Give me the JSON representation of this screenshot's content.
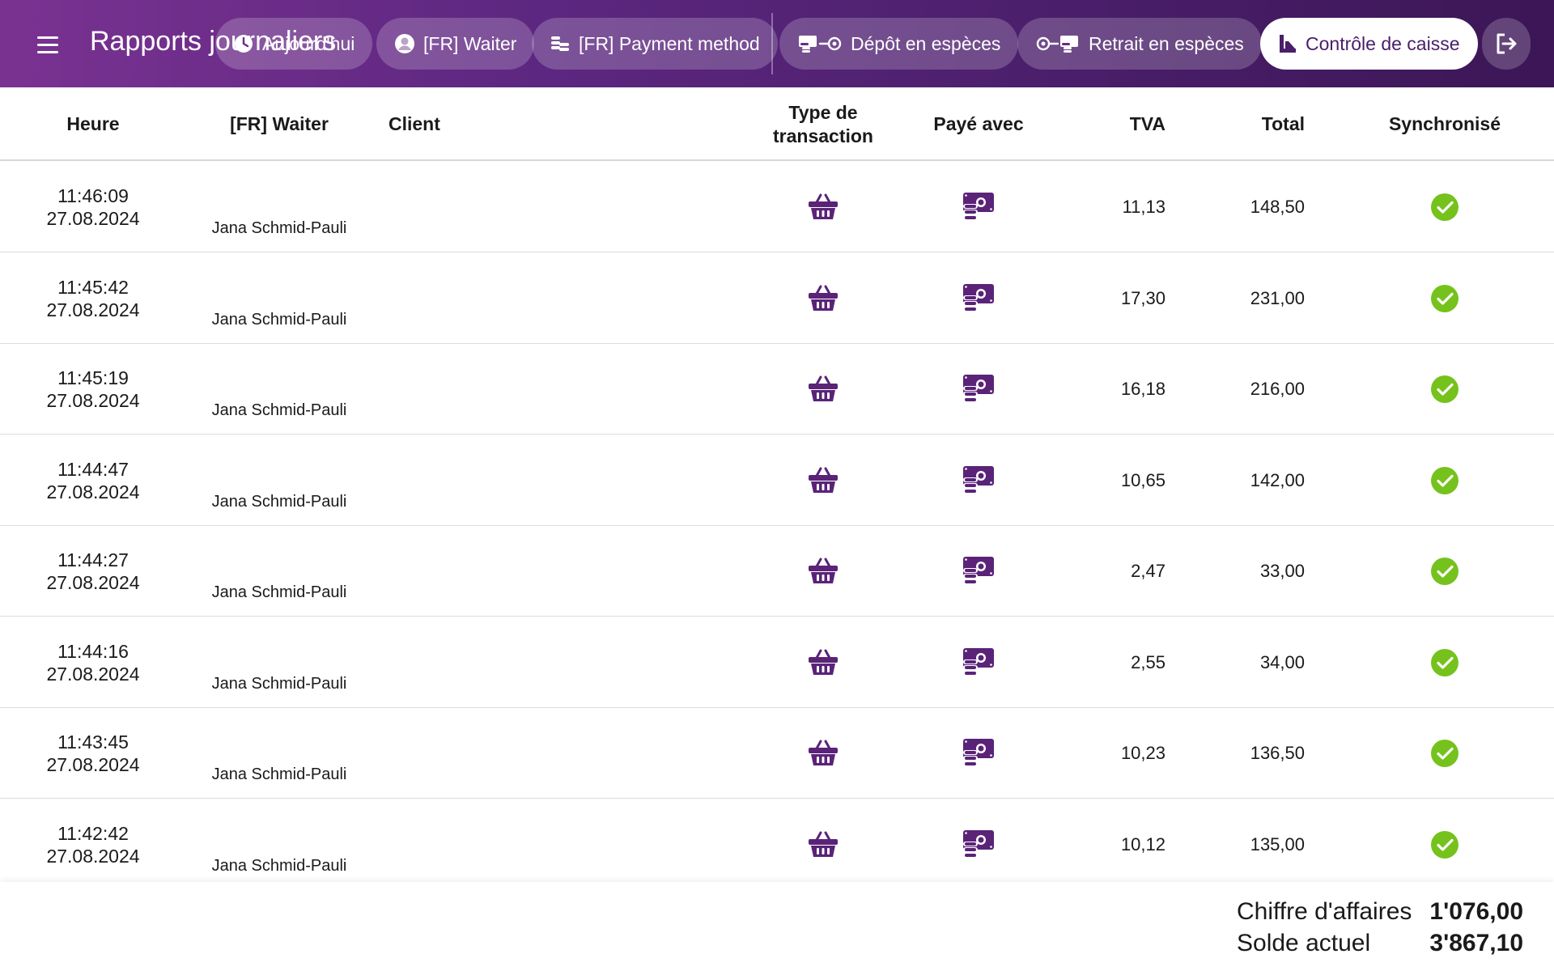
{
  "header": {
    "title": "Rapports journaliers",
    "buttons": {
      "today": "Aujourd'hui",
      "waiter": "[FR] Waiter",
      "payment_method": "[FR] Payment method",
      "cash_deposit": "Dépôt en espèces",
      "cash_withdrawal": "Retrait en espèces",
      "cash_control": "Contrôle de caisse"
    },
    "active_button": "cash_control"
  },
  "table": {
    "columns": {
      "time": "Heure",
      "waiter": "[FR] Waiter",
      "client": "Client",
      "transaction_type_line1": "Type de",
      "transaction_type_line2": "transaction",
      "paid_with": "Payé avec",
      "vat": "TVA",
      "total": "Total",
      "synced": "Synchronisé"
    },
    "rows": [
      {
        "time": "11:46:09",
        "date": "27.08.2024",
        "waiter": "Jana Schmid-Pauli",
        "client": "",
        "transaction_icon": "basket-icon",
        "payment_icon": "cash-icon",
        "vat": "11,13",
        "total": "148,50",
        "synced": true
      },
      {
        "time": "11:45:42",
        "date": "27.08.2024",
        "waiter": "Jana Schmid-Pauli",
        "client": "",
        "transaction_icon": "basket-icon",
        "payment_icon": "cash-icon",
        "vat": "17,30",
        "total": "231,00",
        "synced": true
      },
      {
        "time": "11:45:19",
        "date": "27.08.2024",
        "waiter": "Jana Schmid-Pauli",
        "client": "",
        "transaction_icon": "basket-icon",
        "payment_icon": "cash-icon",
        "vat": "16,18",
        "total": "216,00",
        "synced": true
      },
      {
        "time": "11:44:47",
        "date": "27.08.2024",
        "waiter": "Jana Schmid-Pauli",
        "client": "",
        "transaction_icon": "basket-icon",
        "payment_icon": "cash-icon",
        "vat": "10,65",
        "total": "142,00",
        "synced": true
      },
      {
        "time": "11:44:27",
        "date": "27.08.2024",
        "waiter": "Jana Schmid-Pauli",
        "client": "",
        "transaction_icon": "basket-icon",
        "payment_icon": "cash-icon",
        "vat": "2,47",
        "total": "33,00",
        "synced": true
      },
      {
        "time": "11:44:16",
        "date": "27.08.2024",
        "waiter": "Jana Schmid-Pauli",
        "client": "",
        "transaction_icon": "basket-icon",
        "payment_icon": "cash-icon",
        "vat": "2,55",
        "total": "34,00",
        "synced": true
      },
      {
        "time": "11:43:45",
        "date": "27.08.2024",
        "waiter": "Jana Schmid-Pauli",
        "client": "",
        "transaction_icon": "basket-icon",
        "payment_icon": "cash-icon",
        "vat": "10,23",
        "total": "136,50",
        "synced": true
      },
      {
        "time": "11:42:42",
        "date": "27.08.2024",
        "waiter": "Jana Schmid-Pauli",
        "client": "",
        "transaction_icon": "basket-icon",
        "payment_icon": "cash-icon",
        "vat": "10,12",
        "total": "135,00",
        "synced": true
      }
    ]
  },
  "summary": {
    "revenue_label": "Chiffre d'affaires",
    "revenue_value": "1'076,00",
    "balance_label": "Solde actuel",
    "balance_value": "3'867,10"
  },
  "colors": {
    "brand_purple": "#5c2780",
    "icon_purple": "#5a2378",
    "sync_green": "#76c21d"
  }
}
